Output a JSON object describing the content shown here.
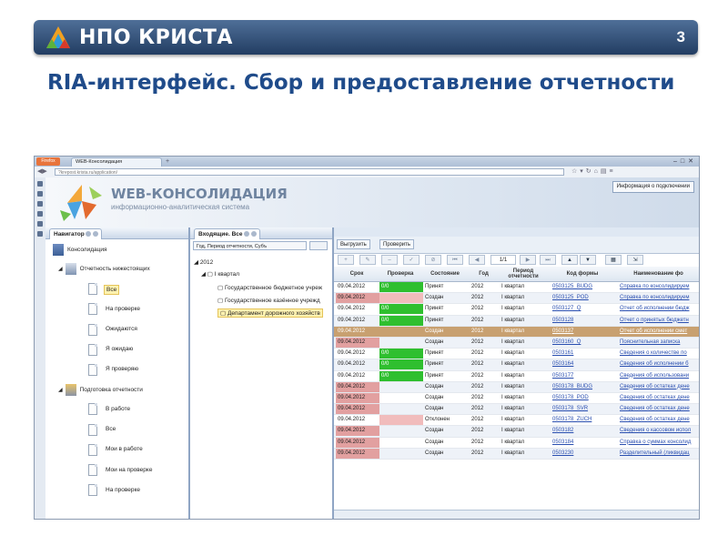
{
  "slide": {
    "logo_text": "НПО КРИСТА",
    "number": "3",
    "title": "RIA-интерфейс. Сбор и предоставление отчетности"
  },
  "browser": {
    "app_button": "Firefox",
    "tab_title": "WEB-Консолидация",
    "address": "?krepost.krista.ru/application/"
  },
  "app": {
    "banner_title": "WEB-КОНСОЛИДАЦИЯ",
    "banner_subtitle": "информационно-аналитическая система",
    "connection_button": "Информация о подключении"
  },
  "navigator": {
    "tab_label": "Навигатор",
    "root": "Консолидация",
    "group1": "Отчетность нижестоящих",
    "group1_items": [
      "Все",
      "На проверке",
      "Ожидаются",
      "Я ожидаю",
      "Я проверяю"
    ],
    "group2": "Подготовка отчетности",
    "group2_items": [
      "В работе",
      "Все",
      "Мои в работе",
      "Мои на проверке",
      "На проверке"
    ]
  },
  "incoming": {
    "tab_label": "Входящие. Все",
    "filter": "Год, Период отчетности, Субъ",
    "tree_year": "2012",
    "tree_quarter": "I квартал",
    "tree_items": [
      "Государственное бюджетное учреж",
      "Государственное казённое учрежд",
      "Департамент дорожного хозяйств"
    ]
  },
  "grid": {
    "toolbar": {
      "upload": "Выгрузить",
      "check": "Проверить",
      "page": "1/1"
    },
    "columns": {
      "date": "Срок",
      "check": "Проверка",
      "state": "Состояние",
      "year": "Год",
      "period": "Период отчетности",
      "form": "Код формы",
      "name": "Наименование фо"
    },
    "rows": [
      {
        "date": "09.04.2012",
        "check": "0/0",
        "state": "Принят",
        "year": "2012",
        "period": "I квартал",
        "form": "0503125_BUDG",
        "name": "Справка по консолидируем",
        "date_style": "plain",
        "check_style": "green",
        "state_style": "plain"
      },
      {
        "date": "09.04.2012",
        "check": "",
        "state": "Создан",
        "year": "2012",
        "period": "I квартал",
        "form": "0503125_POD",
        "name": "Справка по консолидируем",
        "date_style": "red",
        "check_style": "red",
        "state_style": "plain"
      },
      {
        "date": "09.04.2012",
        "check": "0/0",
        "state": "Принят",
        "year": "2012",
        "period": "I квартал",
        "form": "0503127_Q",
        "name": "Отчет об исполнении бюдж",
        "date_style": "plain",
        "check_style": "green",
        "state_style": "plain"
      },
      {
        "date": "09.04.2012",
        "check": "0/0",
        "state": "Принят",
        "year": "2012",
        "period": "I квартал",
        "form": "0503128",
        "name": "Отчет о принятых бюджетн",
        "date_style": "plain",
        "check_style": "green",
        "state_style": "plain"
      },
      {
        "date": "09.04.2012",
        "check": "",
        "state": "Создан",
        "year": "2012",
        "period": "I квартал",
        "form": "0503137",
        "name": "Отчет об исполнении смет",
        "date_style": "red",
        "check_style": "plain",
        "state_style": "plain",
        "highlight": true
      },
      {
        "date": "09.04.2012",
        "check": "",
        "state": "Создан",
        "year": "2012",
        "period": "I квартал",
        "form": "0503160_Q",
        "name": "Пояснительная записка",
        "date_style": "red",
        "check_style": "plain",
        "state_style": "plain"
      },
      {
        "date": "09.04.2012",
        "check": "0/0",
        "state": "Принят",
        "year": "2012",
        "period": "I квартал",
        "form": "0503161",
        "name": "Сведения о количестве по",
        "date_style": "plain",
        "check_style": "green",
        "state_style": "plain"
      },
      {
        "date": "09.04.2012",
        "check": "0/0",
        "state": "Принят",
        "year": "2012",
        "period": "I квартал",
        "form": "0503164",
        "name": "Сведения об исполнении б",
        "date_style": "plain",
        "check_style": "green",
        "state_style": "plain"
      },
      {
        "date": "09.04.2012",
        "check": "0/0",
        "state": "Принят",
        "year": "2012",
        "period": "I квартал",
        "form": "0503177",
        "name": "Сведения об использовани",
        "date_style": "plain",
        "check_style": "green",
        "state_style": "plain"
      },
      {
        "date": "09.04.2012",
        "check": "",
        "state": "Создан",
        "year": "2012",
        "period": "I квартал",
        "form": "0503178_BUDG",
        "name": "Сведения об остатках дене",
        "date_style": "red",
        "check_style": "plain",
        "state_style": "plain"
      },
      {
        "date": "09.04.2012",
        "check": "",
        "state": "Создан",
        "year": "2012",
        "period": "I квартал",
        "form": "0503178_POD",
        "name": "Сведения об остатках дене",
        "date_style": "red",
        "check_style": "plain",
        "state_style": "plain"
      },
      {
        "date": "09.04.2012",
        "check": "",
        "state": "Создан",
        "year": "2012",
        "period": "I квартал",
        "form": "0503178_SVR",
        "name": "Сведения об остатках дене",
        "date_style": "red",
        "check_style": "plain",
        "state_style": "plain"
      },
      {
        "date": "09.04.2012",
        "check": "",
        "state": "Отклонен",
        "year": "2012",
        "period": "I квартал",
        "form": "0503178_ZUCH",
        "name": "Сведения об остатках дене",
        "date_style": "plain",
        "check_style": "red",
        "state_style": "plain"
      },
      {
        "date": "09.04.2012",
        "check": "",
        "state": "Создан",
        "year": "2012",
        "period": "I квартал",
        "form": "0503182",
        "name": "Сведения о кассовом испол",
        "date_style": "red",
        "check_style": "plain",
        "state_style": "plain"
      },
      {
        "date": "09.04.2012",
        "check": "",
        "state": "Создан",
        "year": "2012",
        "period": "I квартал",
        "form": "0503184",
        "name": "Справка о суммах консолид",
        "date_style": "red",
        "check_style": "plain",
        "state_style": "plain"
      },
      {
        "date": "09.04.2012",
        "check": "",
        "state": "Создан",
        "year": "2012",
        "period": "I квартал",
        "form": "0503230",
        "name": "Разделительный (ликвидац",
        "date_style": "red",
        "check_style": "plain",
        "state_style": "plain"
      }
    ]
  },
  "colors": {
    "header_dark": "#223d62",
    "title_blue": "#1f4b8a",
    "check_green": "#2fbf2f",
    "overdue_red": "#e2a0a0",
    "link_blue": "#2a4fb0"
  }
}
